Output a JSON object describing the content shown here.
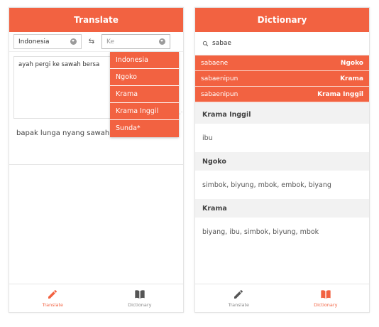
{
  "translate_screen": {
    "title": "Translate",
    "from_lang": "Indonesia",
    "swap_icon": "⇆",
    "to_placeholder": "Ke",
    "input_text": "ayah pergi ke sawah bersa",
    "output_text": "bapak lunga nyang sawah kakang",
    "dropdown_options": [
      "Indonesia",
      "Ngoko",
      "Krama",
      "Krama Inggil",
      "Sunda*"
    ],
    "nav": {
      "translate": "Translate",
      "dictionary": "Dictionary"
    }
  },
  "dictionary_screen": {
    "title": "Dictionary",
    "search_value": "sabae",
    "suggestions": [
      {
        "word": "sabaene",
        "tag": "Ngoko"
      },
      {
        "word": "sabaenipun",
        "tag": "Krama"
      },
      {
        "word": "sabaenipun",
        "tag": "Krama Inggil"
      }
    ],
    "sections": [
      {
        "heading": "Krama Inggil",
        "body": "ibu"
      },
      {
        "heading": "Ngoko",
        "body": "simbok, biyung, mbok, embok, biyang"
      },
      {
        "heading": "Krama",
        "body": "biyang, ibu, simbok, biyung, mbok"
      }
    ],
    "nav": {
      "translate": "Translate",
      "dictionary": "Dictionary"
    }
  },
  "colors": {
    "accent": "#f26241",
    "inactive": "#888888"
  }
}
